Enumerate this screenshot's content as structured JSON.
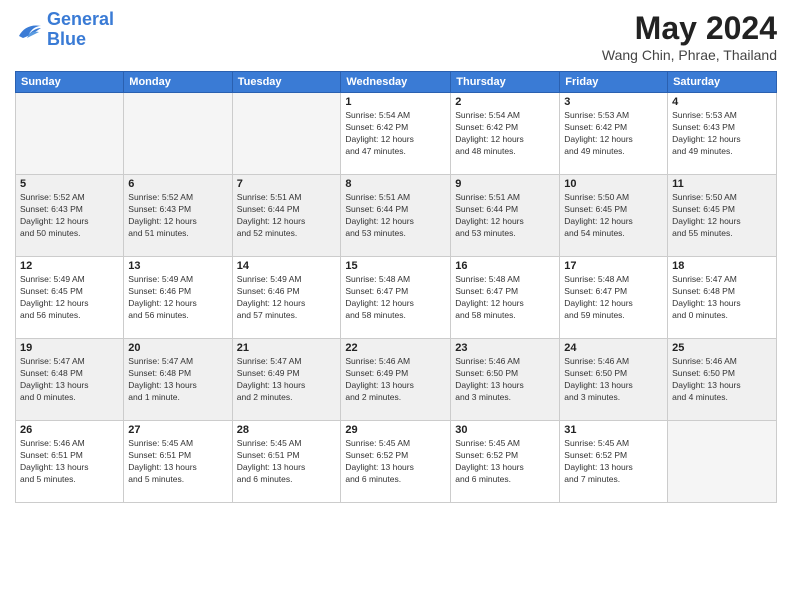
{
  "logo": {
    "line1": "General",
    "line2": "Blue"
  },
  "title": "May 2024",
  "location": "Wang Chin, Phrae, Thailand",
  "weekdays": [
    "Sunday",
    "Monday",
    "Tuesday",
    "Wednesday",
    "Thursday",
    "Friday",
    "Saturday"
  ],
  "weeks": [
    [
      {
        "day": "",
        "info": ""
      },
      {
        "day": "",
        "info": ""
      },
      {
        "day": "",
        "info": ""
      },
      {
        "day": "1",
        "info": "Sunrise: 5:54 AM\nSunset: 6:42 PM\nDaylight: 12 hours\nand 47 minutes."
      },
      {
        "day": "2",
        "info": "Sunrise: 5:54 AM\nSunset: 6:42 PM\nDaylight: 12 hours\nand 48 minutes."
      },
      {
        "day": "3",
        "info": "Sunrise: 5:53 AM\nSunset: 6:42 PM\nDaylight: 12 hours\nand 49 minutes."
      },
      {
        "day": "4",
        "info": "Sunrise: 5:53 AM\nSunset: 6:43 PM\nDaylight: 12 hours\nand 49 minutes."
      }
    ],
    [
      {
        "day": "5",
        "info": "Sunrise: 5:52 AM\nSunset: 6:43 PM\nDaylight: 12 hours\nand 50 minutes."
      },
      {
        "day": "6",
        "info": "Sunrise: 5:52 AM\nSunset: 6:43 PM\nDaylight: 12 hours\nand 51 minutes."
      },
      {
        "day": "7",
        "info": "Sunrise: 5:51 AM\nSunset: 6:44 PM\nDaylight: 12 hours\nand 52 minutes."
      },
      {
        "day": "8",
        "info": "Sunrise: 5:51 AM\nSunset: 6:44 PM\nDaylight: 12 hours\nand 53 minutes."
      },
      {
        "day": "9",
        "info": "Sunrise: 5:51 AM\nSunset: 6:44 PM\nDaylight: 12 hours\nand 53 minutes."
      },
      {
        "day": "10",
        "info": "Sunrise: 5:50 AM\nSunset: 6:45 PM\nDaylight: 12 hours\nand 54 minutes."
      },
      {
        "day": "11",
        "info": "Sunrise: 5:50 AM\nSunset: 6:45 PM\nDaylight: 12 hours\nand 55 minutes."
      }
    ],
    [
      {
        "day": "12",
        "info": "Sunrise: 5:49 AM\nSunset: 6:45 PM\nDaylight: 12 hours\nand 56 minutes."
      },
      {
        "day": "13",
        "info": "Sunrise: 5:49 AM\nSunset: 6:46 PM\nDaylight: 12 hours\nand 56 minutes."
      },
      {
        "day": "14",
        "info": "Sunrise: 5:49 AM\nSunset: 6:46 PM\nDaylight: 12 hours\nand 57 minutes."
      },
      {
        "day": "15",
        "info": "Sunrise: 5:48 AM\nSunset: 6:47 PM\nDaylight: 12 hours\nand 58 minutes."
      },
      {
        "day": "16",
        "info": "Sunrise: 5:48 AM\nSunset: 6:47 PM\nDaylight: 12 hours\nand 58 minutes."
      },
      {
        "day": "17",
        "info": "Sunrise: 5:48 AM\nSunset: 6:47 PM\nDaylight: 12 hours\nand 59 minutes."
      },
      {
        "day": "18",
        "info": "Sunrise: 5:47 AM\nSunset: 6:48 PM\nDaylight: 13 hours\nand 0 minutes."
      }
    ],
    [
      {
        "day": "19",
        "info": "Sunrise: 5:47 AM\nSunset: 6:48 PM\nDaylight: 13 hours\nand 0 minutes."
      },
      {
        "day": "20",
        "info": "Sunrise: 5:47 AM\nSunset: 6:48 PM\nDaylight: 13 hours\nand 1 minute."
      },
      {
        "day": "21",
        "info": "Sunrise: 5:47 AM\nSunset: 6:49 PM\nDaylight: 13 hours\nand 2 minutes."
      },
      {
        "day": "22",
        "info": "Sunrise: 5:46 AM\nSunset: 6:49 PM\nDaylight: 13 hours\nand 2 minutes."
      },
      {
        "day": "23",
        "info": "Sunrise: 5:46 AM\nSunset: 6:50 PM\nDaylight: 13 hours\nand 3 minutes."
      },
      {
        "day": "24",
        "info": "Sunrise: 5:46 AM\nSunset: 6:50 PM\nDaylight: 13 hours\nand 3 minutes."
      },
      {
        "day": "25",
        "info": "Sunrise: 5:46 AM\nSunset: 6:50 PM\nDaylight: 13 hours\nand 4 minutes."
      }
    ],
    [
      {
        "day": "26",
        "info": "Sunrise: 5:46 AM\nSunset: 6:51 PM\nDaylight: 13 hours\nand 5 minutes."
      },
      {
        "day": "27",
        "info": "Sunrise: 5:45 AM\nSunset: 6:51 PM\nDaylight: 13 hours\nand 5 minutes."
      },
      {
        "day": "28",
        "info": "Sunrise: 5:45 AM\nSunset: 6:51 PM\nDaylight: 13 hours\nand 6 minutes."
      },
      {
        "day": "29",
        "info": "Sunrise: 5:45 AM\nSunset: 6:52 PM\nDaylight: 13 hours\nand 6 minutes."
      },
      {
        "day": "30",
        "info": "Sunrise: 5:45 AM\nSunset: 6:52 PM\nDaylight: 13 hours\nand 6 minutes."
      },
      {
        "day": "31",
        "info": "Sunrise: 5:45 AM\nSunset: 6:52 PM\nDaylight: 13 hours\nand 7 minutes."
      },
      {
        "day": "",
        "info": ""
      }
    ]
  ]
}
